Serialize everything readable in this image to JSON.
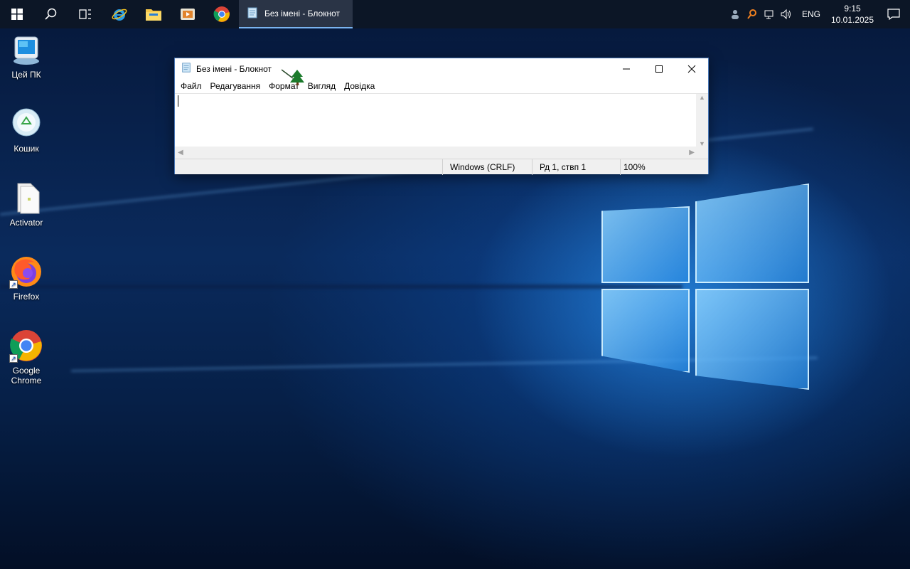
{
  "taskbar": {
    "start_icon": "windows-logo-icon",
    "search_icon": "search-icon",
    "taskview_icon": "task-view-icon",
    "pinned": [
      {
        "name": "internet-explorer-icon"
      },
      {
        "name": "file-explorer-icon"
      },
      {
        "name": "media-player-icon"
      },
      {
        "name": "chrome-icon"
      }
    ],
    "active_task": "Без імені - Блокнот"
  },
  "tray": {
    "language": "ENG",
    "time": "9:15",
    "date": "10.01.2025"
  },
  "desktop": {
    "icons": [
      {
        "label": "Цей ПК"
      },
      {
        "label": "Кошик"
      },
      {
        "label": "Activator"
      },
      {
        "label": "Firefox"
      },
      {
        "label": "Google Chrome"
      }
    ]
  },
  "notepad": {
    "title": "Без імені - Блокнот",
    "menu": [
      "Файл",
      "Редагування",
      "Формат",
      "Вигляд",
      "Довідка"
    ],
    "status": {
      "line_ending": "Windows (CRLF)",
      "position": "Рд 1, ствп 1",
      "zoom": "100%"
    }
  },
  "colors": {
    "taskbar": "#0c1626",
    "accent": "#7ab4f0"
  }
}
